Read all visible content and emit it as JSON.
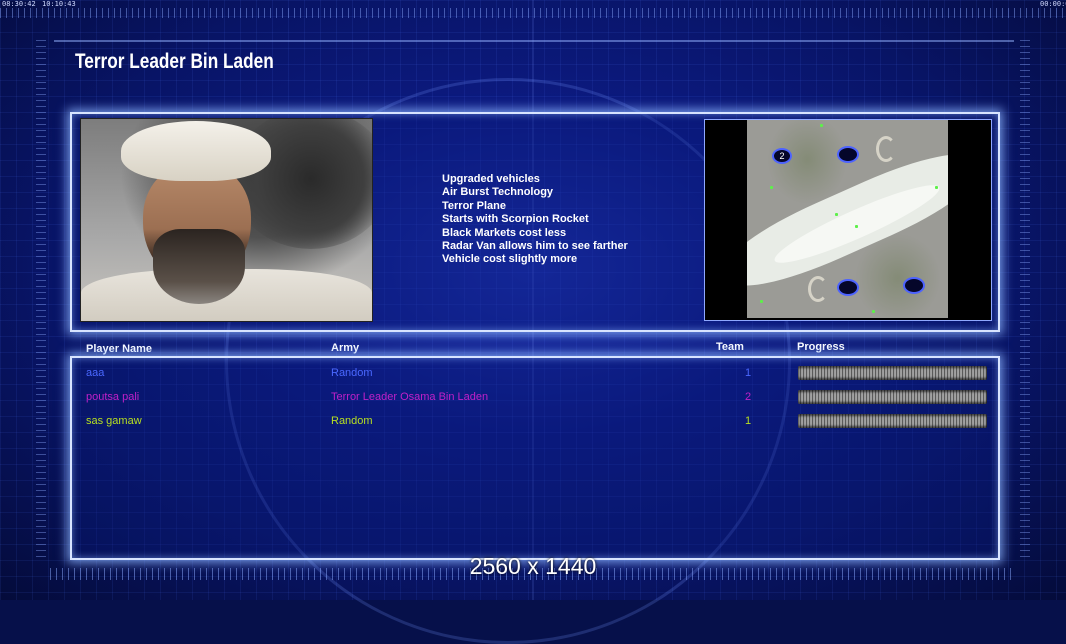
{
  "hud": {
    "clock_left": "08:30:42",
    "clock_mid": "10:10:43",
    "clock_right": "00:00:00"
  },
  "title": "Terror Leader Bin Laden",
  "general_traits": [
    "Upgraded vehicles",
    "Air Burst Technology",
    "Terror Plane",
    "Starts with Scorpion Rocket",
    "Black Markets cost less",
    "Radar Van allows him to see farther",
    "Vehicle cost slightly more"
  ],
  "minimap": {
    "slot_label": "2"
  },
  "table": {
    "headers": {
      "player": "Player Name",
      "army": "Army",
      "team": "Team",
      "progress": "Progress"
    },
    "rows": [
      {
        "name": "aaa",
        "army": "Random",
        "team": "1",
        "color": "#4a68ff",
        "progress": 1.0
      },
      {
        "name": "poutsa pali",
        "army": "Terror Leader Osama Bin Laden",
        "team": "2",
        "color": "#c020c8",
        "progress": 1.0
      },
      {
        "name": "sas gamaw",
        "army": "Random",
        "team": "1",
        "color": "#b8e020",
        "progress": 1.0
      }
    ]
  },
  "resolution_label": "2560 x 1440"
}
